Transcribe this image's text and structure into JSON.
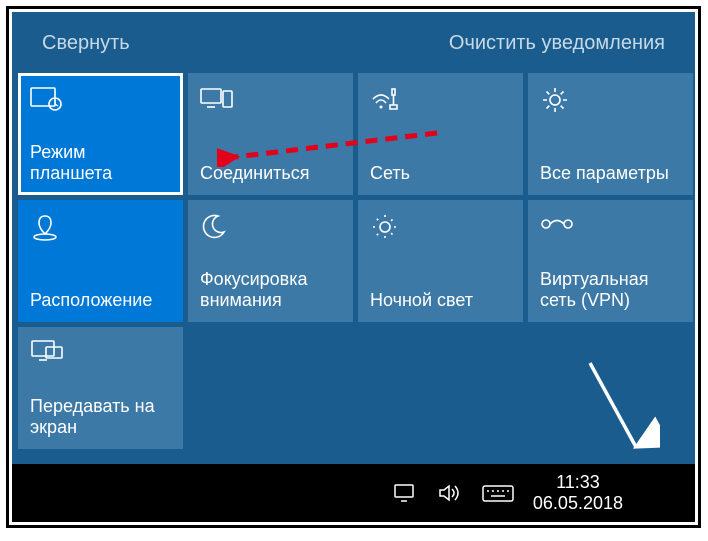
{
  "header": {
    "collapse": "Свернуть",
    "clear": "Очистить уведомления"
  },
  "tiles": [
    {
      "label": "Режим планшета"
    },
    {
      "label": "Соединиться"
    },
    {
      "label": "Сеть"
    },
    {
      "label": "Все параметры"
    },
    {
      "label": "Расположение"
    },
    {
      "label": "Фокусировка внимания"
    },
    {
      "label": "Ночной свет"
    },
    {
      "label": "Виртуальная сеть (VPN)"
    },
    {
      "label": "Передавать на экран"
    }
  ],
  "taskbar": {
    "time": "11:33",
    "date": "06.05.2018"
  }
}
